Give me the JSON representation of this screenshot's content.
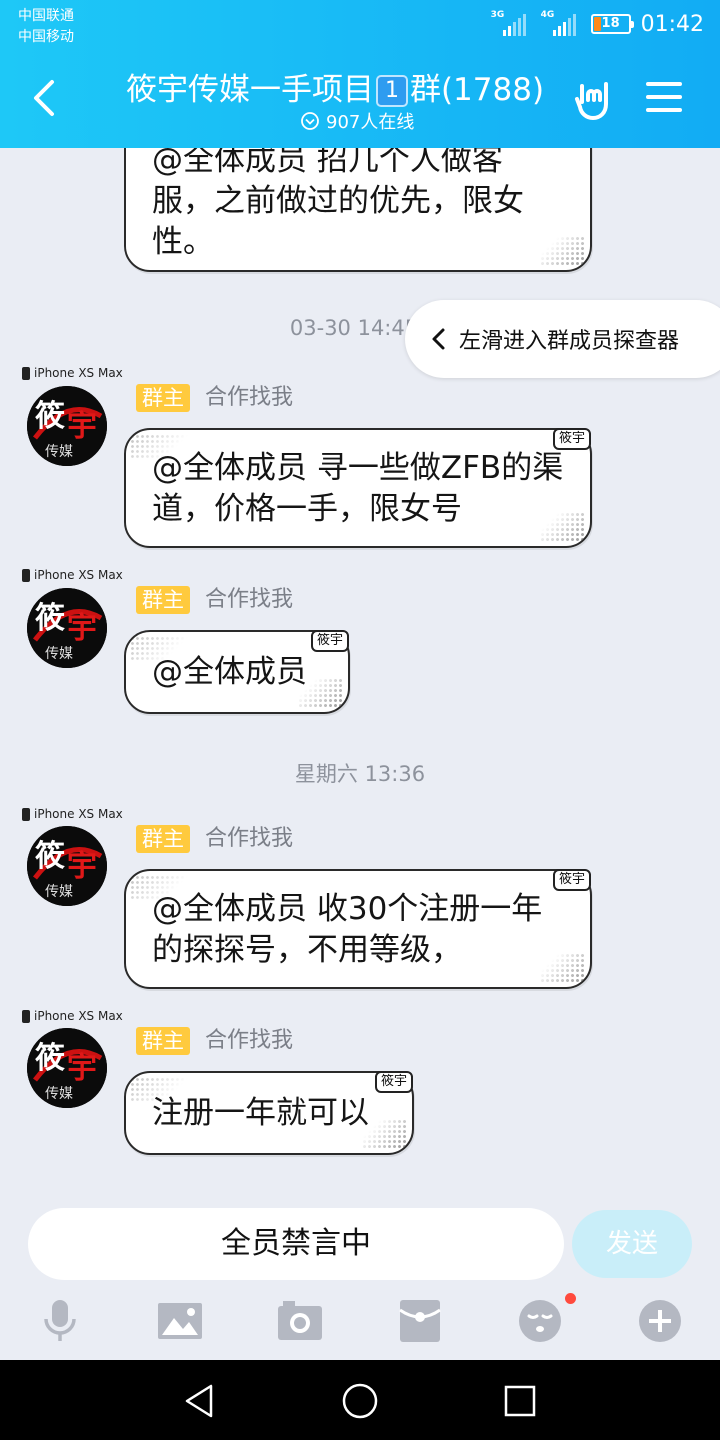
{
  "status_bar": {
    "carrier_1": "中国联通",
    "carrier_2": "中国移动",
    "net_1": "3G",
    "net_2": "4G",
    "battery": "18",
    "time": "01:42"
  },
  "header": {
    "title_prefix": "筱宇传媒一手项目",
    "title_badge": "1",
    "title_suffix": "群(1788)",
    "online": "907人在线",
    "icons": [
      "back-icon",
      "hand-gesture-icon",
      "menu-icon"
    ]
  },
  "chat": {
    "top_partial_text_1": "@全体成员 招几个人做客",
    "top_partial_text_2": "服，之前做过的优先，限女",
    "top_partial_text_3": "性。",
    "time_1": "03-30 14:45",
    "swipe_hint": "左滑进入群成员探查器",
    "time_2": "星期六 13:36",
    "messages": [
      {
        "device": "iPhone XS Max",
        "role": "群主",
        "nick": "合作找我",
        "stamp": "筱宇",
        "text": "@全体成员 寻一些做ZFB的渠道，价格一手，限女号"
      },
      {
        "device": "iPhone XS Max",
        "role": "群主",
        "nick": "合作找我",
        "stamp": "筱宇",
        "text": "@全体成员"
      },
      {
        "device": "iPhone XS Max",
        "role": "群主",
        "nick": "合作找我",
        "stamp": "筱宇",
        "text": "@全体成员 收30个注册一年的探探号，不用等级，"
      },
      {
        "device": "iPhone XS Max",
        "role": "群主",
        "nick": "合作找我",
        "stamp": "筱宇",
        "text": "注册一年就可以"
      }
    ],
    "avatar_text_1": "筱",
    "avatar_text_2": "宇",
    "avatar_text_3": "传媒"
  },
  "input": {
    "placeholder": "全员禁言中",
    "send_label": "发送"
  },
  "toolbar": {
    "icons": [
      "microphone-icon",
      "image-icon",
      "camera-icon",
      "red-packet-icon",
      "emoji-icon",
      "plus-icon"
    ],
    "emoji_badge_color": "#ff4a3d"
  },
  "colors": {
    "header_start": "#1ec8f7",
    "header_end": "#12acf4",
    "chat_bg": "#eaedf4",
    "role_badge": "#ffca3e",
    "send_disabled": "#c9eef9"
  }
}
